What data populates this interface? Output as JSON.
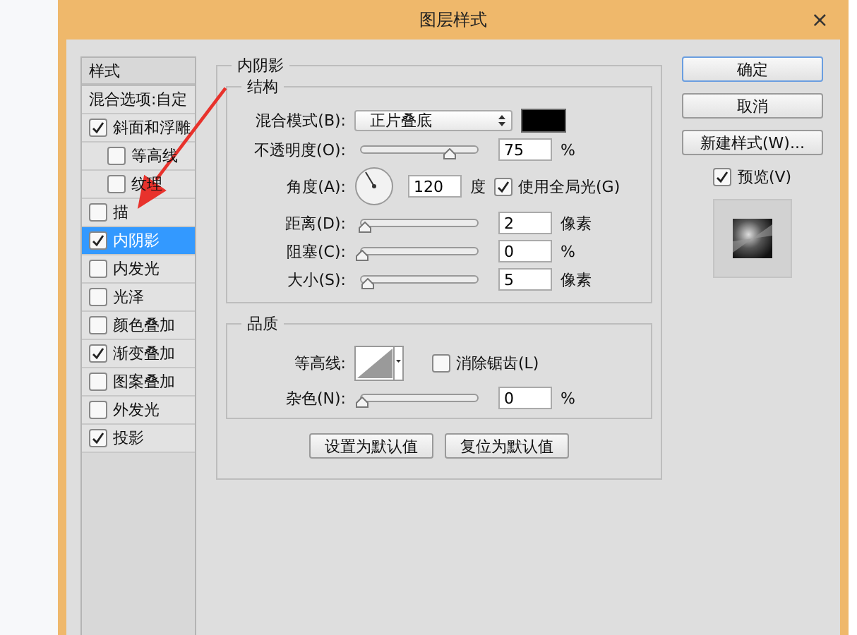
{
  "window": {
    "title": "图层样式",
    "close": "×"
  },
  "styles": {
    "header": "样式",
    "blend_options": "混合选项:自定",
    "items": [
      {
        "label": "斜面和浮雕",
        "checked": true,
        "selected": false,
        "children": [
          {
            "label": "等高线",
            "checked": false,
            "selected": false
          },
          {
            "label": "纹理",
            "checked": false,
            "selected": false
          }
        ]
      },
      {
        "label": "描",
        "checked": false,
        "selected": false
      },
      {
        "label": "内阴影",
        "checked": true,
        "selected": true
      },
      {
        "label": "内发光",
        "checked": false,
        "selected": false
      },
      {
        "label": "光泽",
        "checked": false,
        "selected": false
      },
      {
        "label": "颜色叠加",
        "checked": false,
        "selected": false
      },
      {
        "label": "渐变叠加",
        "checked": true,
        "selected": false
      },
      {
        "label": "图案叠加",
        "checked": false,
        "selected": false
      },
      {
        "label": "外发光",
        "checked": false,
        "selected": false
      },
      {
        "label": "投影",
        "checked": true,
        "selected": false
      }
    ]
  },
  "panel": {
    "title": "内阴影",
    "structure": {
      "title": "结构",
      "blend_mode": {
        "label": "混合模式(B):",
        "value": "正片叠底",
        "color": "#000000"
      },
      "opacity": {
        "label": "不透明度(O):",
        "level": 0.75,
        "value": "75",
        "unit": "%"
      },
      "angle": {
        "label": "角度(A):",
        "value": "120",
        "unit": "度",
        "global_light": {
          "label": "使用全局光(G)",
          "checked": true
        }
      },
      "sliders": [
        {
          "label": "距离(D):",
          "level": 0.03,
          "value": "2",
          "unit": "像素"
        },
        {
          "label": "阻塞(C):",
          "level": 0,
          "value": "0",
          "unit": "%"
        },
        {
          "label": "大小(S):",
          "level": 0.05,
          "value": "5",
          "unit": "像素"
        }
      ]
    },
    "quality": {
      "title": "品质",
      "contour": {
        "label": "等高线:"
      },
      "anti_alias": {
        "label": "消除锯齿(L)",
        "checked": false
      },
      "noise": {
        "label": "杂色(N):",
        "level": 0,
        "value": "0",
        "unit": "%"
      }
    },
    "buttons": [
      "设置为默认值",
      "复位为默认值"
    ]
  },
  "actions": [
    {
      "label": "确定",
      "default": true
    },
    {
      "label": "取消",
      "default": false
    },
    {
      "label": "新建样式(W)...",
      "default": false
    }
  ],
  "preview": {
    "label": "预览(V)",
    "checked": true
  }
}
